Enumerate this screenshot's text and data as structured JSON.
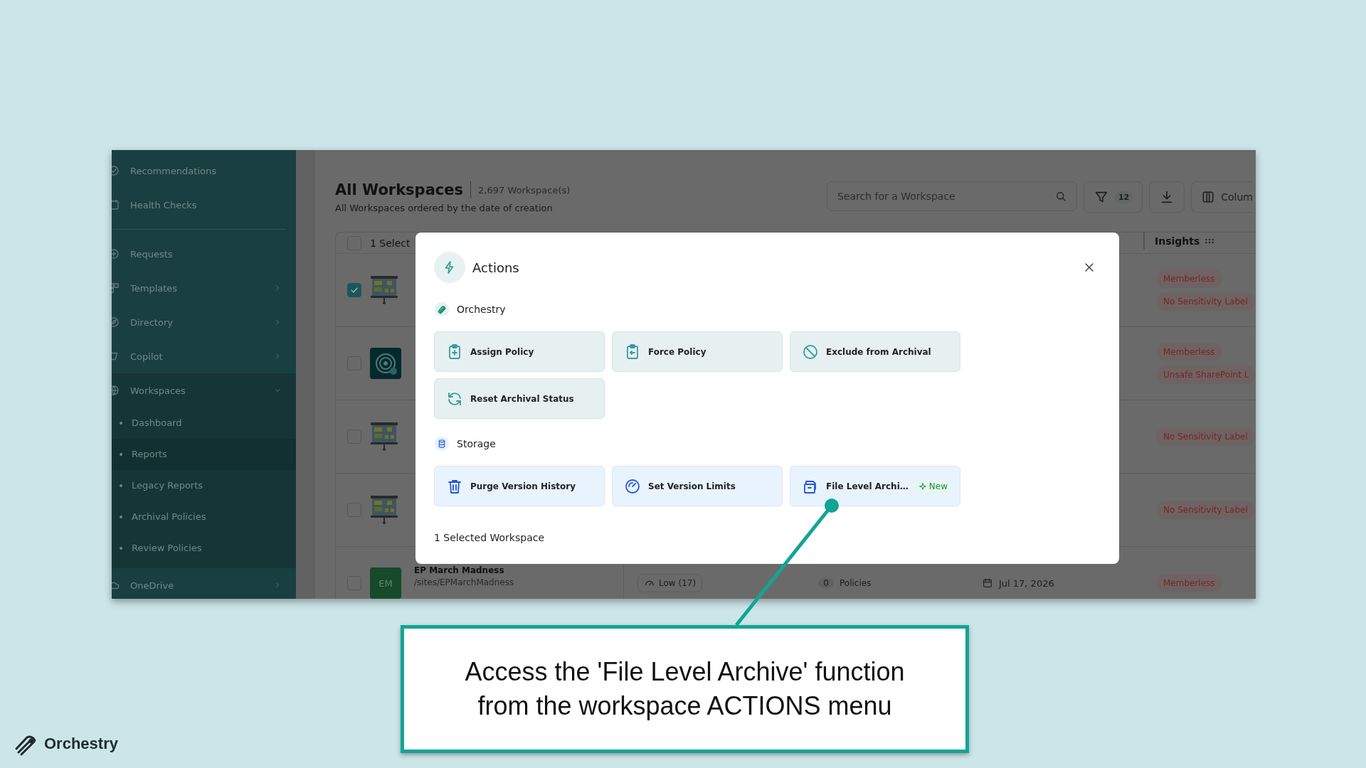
{
  "sidebar": {
    "items": [
      {
        "label": "Recommendations"
      },
      {
        "label": "Health Checks",
        "divider_after": true
      },
      {
        "label": "Requests"
      },
      {
        "label": "Templates",
        "expanded": false
      },
      {
        "label": "Directory",
        "expanded": false
      },
      {
        "label": "Copilot",
        "expanded": false
      },
      {
        "label": "Workspaces",
        "expanded": true,
        "children": [
          {
            "label": "Dashboard",
            "selected": false
          },
          {
            "label": "Reports",
            "selected": true
          },
          {
            "label": "Legacy Reports",
            "selected": false
          },
          {
            "label": "Archival Policies",
            "selected": false
          },
          {
            "label": "Review Policies",
            "selected": false
          }
        ]
      },
      {
        "label": "OneDrive",
        "expanded": false
      }
    ]
  },
  "header": {
    "title": "All Workspaces",
    "count": "2,697 Workspace(s)",
    "subtitle": "All Workspaces ordered by the date of creation",
    "search": {
      "placeholder": "Search for a Workspace"
    },
    "filter_count": "12",
    "columns_button": "Colum"
  },
  "table": {
    "select_all_checked": false,
    "select_label": "1 Select",
    "insights_column": "Insights",
    "rows": [
      {
        "checked": true,
        "kind": "board",
        "insights": [
          "Memberless",
          "No Sensitivity Label"
        ]
      },
      {
        "checked": false,
        "kind": "target",
        "insights": [
          "Memberless",
          "Unsafe SharePoint L"
        ]
      },
      {
        "checked": false,
        "kind": "board",
        "insights": [
          "No Sensitivity Label"
        ]
      },
      {
        "checked": false,
        "kind": "board",
        "insights": [
          "No Sensitivity Label"
        ]
      },
      {
        "checked": false,
        "kind": "initials",
        "initials": "EM",
        "title": "EP March Madness",
        "path": "/sites/EPMarchMadness",
        "activity": "Low (17)",
        "policy_count": "0",
        "policy_label": "Policies",
        "date": "Jul 17, 2026",
        "insights": [
          "Memberless"
        ]
      }
    ]
  },
  "modal": {
    "title": "Actions",
    "sections": [
      {
        "title": "Orchestry",
        "kind": "orchestry",
        "actions": [
          {
            "label": "Assign Policy"
          },
          {
            "label": "Force Policy"
          },
          {
            "label": "Exclude from Archival"
          },
          {
            "label": "Reset Archival Status"
          }
        ]
      },
      {
        "title": "Storage",
        "kind": "storage",
        "actions": [
          {
            "label": "Purge Version History"
          },
          {
            "label": "Set Version Limits"
          },
          {
            "label": "File Level Archi…",
            "badge": "New"
          }
        ]
      }
    ],
    "footer": "1 Selected Workspace"
  },
  "callout": {
    "text": "Access the 'File Level Archive' function from the workspace ACTIONS menu"
  },
  "brand": {
    "name": "Orchestry"
  }
}
